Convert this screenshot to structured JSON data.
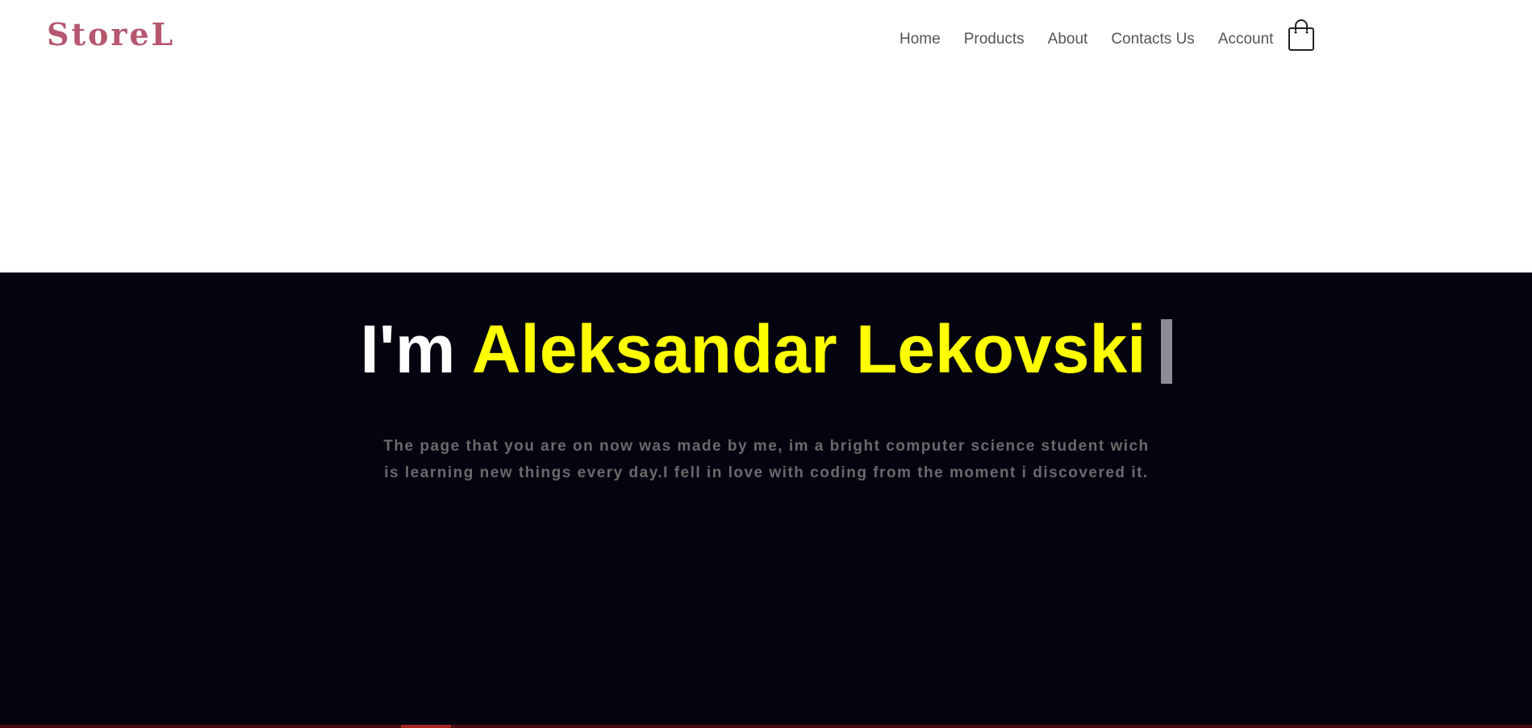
{
  "brand": {
    "logo_text": "StoreL"
  },
  "nav": {
    "items": [
      {
        "label": "Home"
      },
      {
        "label": "Products"
      },
      {
        "label": "About"
      },
      {
        "label": "Contacts Us"
      },
      {
        "label": "Account"
      }
    ],
    "cart_icon": "shopping-bag-icon"
  },
  "hero": {
    "title_prefix": "I'm",
    "title_name": "Aleksandar Lekovski",
    "description": "The page that you are on now was made by me, im a bright computer science student wich is learning new things every day.I fell in love with coding from the moment i discovered it."
  },
  "colors": {
    "brand": "#b5576f",
    "hero_background": "#03040f",
    "name_highlight": "#ffff00",
    "description_text": "#6a6a6a"
  }
}
